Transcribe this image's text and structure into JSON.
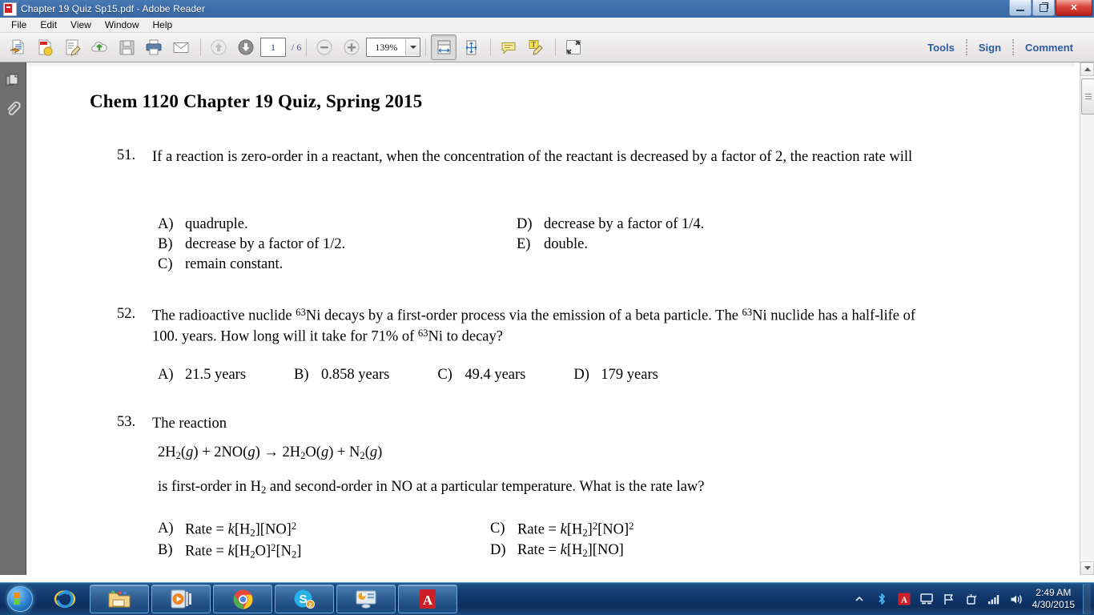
{
  "window": {
    "title": "Chapter 19 Quiz Sp15.pdf - Adobe Reader",
    "app_icon": "pdf-icon",
    "minimize_label": "",
    "restore_label": "",
    "close_label": "✕"
  },
  "menu": {
    "items": [
      {
        "label": "File"
      },
      {
        "label": "Edit"
      },
      {
        "label": "View"
      },
      {
        "label": "Window"
      },
      {
        "label": "Help"
      }
    ]
  },
  "toolbar": {
    "buttons": [
      {
        "name": "open-file-icon"
      },
      {
        "name": "create-pdf-icon"
      },
      {
        "name": "edit-pdf-icon"
      },
      {
        "name": "upload-cloud-icon"
      },
      {
        "name": "save-icon"
      },
      {
        "name": "print-icon"
      },
      {
        "name": "email-icon"
      },
      {
        "name": "previous-page-icon"
      },
      {
        "name": "next-page-icon"
      }
    ],
    "page_current": "1",
    "page_total": "/ 6",
    "zoom_out_icon": "minus-icon",
    "zoom_in_icon": "plus-icon",
    "zoom_value": "139%",
    "zoom_dropdown_icon": "chevron-down-icon",
    "fit_width_icon": "fit-width-icon",
    "fit_page_icon": "fit-page-icon",
    "sticky_note_icon": "comment-balloon-icon",
    "highlight_icon": "highlight-text-icon",
    "fullscreen_icon": "read-mode-icon",
    "tools_label": "Tools",
    "sign_label": "Sign",
    "comment_label": "Comment"
  },
  "sidebar": {
    "items": [
      {
        "name": "page-thumbnails-icon",
        "label": "Page Thumbnails"
      },
      {
        "name": "attachments-icon",
        "label": "Attachments"
      }
    ]
  },
  "document": {
    "heading": "Chem 1120 Chapter 19 Quiz, Spring 2015",
    "questions": [
      {
        "number": "51.",
        "text": "If a reaction is zero-order in a reactant, when the concentration of the reactant is decreased by a factor of 2, the reaction rate will",
        "options": [
          {
            "letter": "A)",
            "text": "quadruple."
          },
          {
            "letter": "D)",
            "text": "decrease by a factor of 1/4."
          },
          {
            "letter": "B)",
            "text": "decrease by a factor of 1/2."
          },
          {
            "letter": "E)",
            "text": "double."
          },
          {
            "letter": "C)",
            "text": "remain constant."
          },
          {
            "letter": "",
            "text": ""
          }
        ]
      },
      {
        "number": "52.",
        "line1_a": "The radioactive nuclide ",
        "line1_sup": "63",
        "line1_b": "Ni decays by a first-order process via the emission of a beta particle. The ",
        "line1_sup2": "63",
        "line1_c": "Ni nuclide has a half-life of 100. years. How long will it take for 71% of ",
        "line1_sup3": "63",
        "line1_d": "Ni to decay?",
        "options": [
          {
            "letter": "A)",
            "text": "21.5 years"
          },
          {
            "letter": "B)",
            "text": "0.858 years"
          },
          {
            "letter": "C)",
            "text": "49.4 years"
          },
          {
            "letter": "D)",
            "text": "179 years"
          }
        ]
      },
      {
        "number": "53.",
        "text": "The reaction",
        "equation": "2H2(g) + 2NO(g) → 2H2O(g) + N2(g)",
        "followup": "is first-order in H2 and second-order in NO at a particular temperature. What is the rate law?",
        "options": [
          {
            "letter": "A)",
            "text": "Rate = k[H2][NO]2"
          },
          {
            "letter": "C)",
            "text": "Rate = k[H2]2[NO]2"
          },
          {
            "letter": "B)",
            "text": "Rate = k[H2O]2[N2]"
          },
          {
            "letter": "D)",
            "text": "Rate = k[H2][NO]"
          }
        ]
      }
    ]
  },
  "scrollbar": {
    "up_icon": "scroll-up-icon",
    "down_icon": "scroll-down-icon"
  },
  "taskbar": {
    "start_label": "Start",
    "items": [
      {
        "name": "internet-explorer-icon",
        "label": "Internet Explorer"
      },
      {
        "name": "windows-explorer-icon",
        "label": "Windows Explorer"
      },
      {
        "name": "media-player-icon",
        "label": "Windows Media Player"
      },
      {
        "name": "google-chrome-icon",
        "label": "Google Chrome"
      },
      {
        "name": "skype-icon",
        "label": "Skype",
        "badge": "2"
      },
      {
        "name": "remote-desktop-icon",
        "label": "Remote Desktop"
      },
      {
        "name": "adobe-reader-icon",
        "label": "Adobe Reader"
      }
    ],
    "tray": [
      {
        "name": "show-hidden-icons-icon"
      },
      {
        "name": "bluetooth-icon"
      },
      {
        "name": "adobe-updater-icon"
      },
      {
        "name": "network-monitor-icon"
      },
      {
        "name": "flag-action-center-icon"
      },
      {
        "name": "safely-remove-hardware-icon"
      },
      {
        "name": "signal-strength-icon"
      },
      {
        "name": "volume-icon"
      }
    ],
    "clock_time": "2:49 AM",
    "clock_date": "4/30/2015"
  },
  "colors": {
    "titlebar": "#3a6aa5",
    "toolbar_link": "#2d5b9e",
    "taskbar": "#10366b",
    "sidebar": "#6e6e6e"
  }
}
